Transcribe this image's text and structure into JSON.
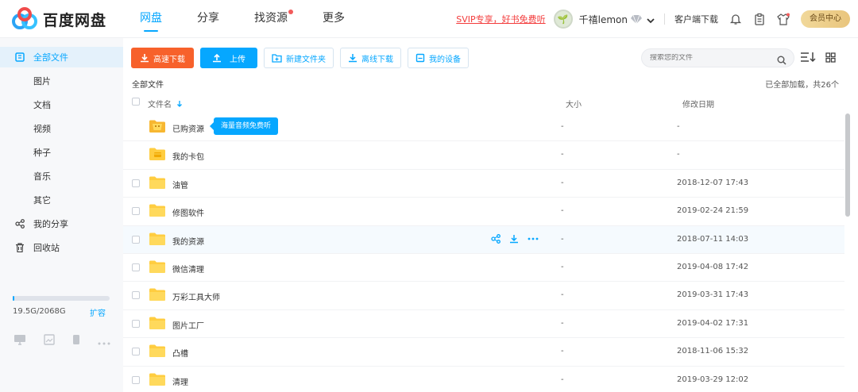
{
  "header": {
    "logo_text": "百度网盘",
    "nav": [
      {
        "label": "网盘",
        "active": true
      },
      {
        "label": "分享",
        "active": false
      },
      {
        "label": "找资源",
        "active": false,
        "dot": true
      },
      {
        "label": "更多",
        "active": false
      }
    ],
    "promo": "SVIP专享，好书免费听",
    "avatar_glyph": "🌱",
    "user_name": "千禧lemon",
    "client_download": "客户端下载",
    "vip_center": "会员中心"
  },
  "sidebar": {
    "items": [
      {
        "label": "全部文件",
        "icon": "all-files-icon",
        "active": true
      },
      {
        "label": "图片"
      },
      {
        "label": "文档"
      },
      {
        "label": "视频"
      },
      {
        "label": "种子"
      },
      {
        "label": "音乐"
      },
      {
        "label": "其它"
      },
      {
        "label": "我的分享",
        "icon": "share-icon"
      },
      {
        "label": "回收站",
        "icon": "trash-icon"
      }
    ],
    "quota_text": "19.5G/2068G",
    "quota_used_fraction": 0.009,
    "expand_label": "扩容"
  },
  "toolbar": {
    "fast_download": "高速下载",
    "upload": "上传",
    "new_folder": "新建文件夹",
    "offline_download": "离线下载",
    "my_devices": "我的设备"
  },
  "search": {
    "placeholder": "搜索您的文件"
  },
  "breadcrumb": "全部文件",
  "loaded_status": "已全部加载，共26个",
  "table": {
    "col_name": "文件名",
    "col_size": "大小",
    "col_date": "修改日期"
  },
  "tooltip": "海量音频免费听",
  "files": [
    {
      "name": "已购资源",
      "size": "-",
      "date": "-",
      "special": "purchase"
    },
    {
      "name": "我的卡包",
      "size": "-",
      "date": "-",
      "special": "card"
    },
    {
      "name": "油管",
      "size": "-",
      "date": "2018-12-07 17:43"
    },
    {
      "name": "修图软件",
      "size": "-",
      "date": "2019-02-24 21:59"
    },
    {
      "name": "我的资源",
      "size": "-",
      "date": "2018-07-11 14:03",
      "hover": true
    },
    {
      "name": "微信清理",
      "size": "-",
      "date": "2019-04-08 17:42"
    },
    {
      "name": "万彩工具大师",
      "size": "-",
      "date": "2019-03-31 17:43"
    },
    {
      "name": "图片工厂",
      "size": "-",
      "date": "2019-04-02 17:31"
    },
    {
      "name": "凸槽",
      "size": "-",
      "date": "2018-11-06 15:32"
    },
    {
      "name": "清理",
      "size": "-",
      "date": "2019-03-29 12:02"
    }
  ],
  "colors": {
    "accent": "#06a7ff",
    "orange": "#f7612b",
    "folder": "#ffcd40"
  }
}
